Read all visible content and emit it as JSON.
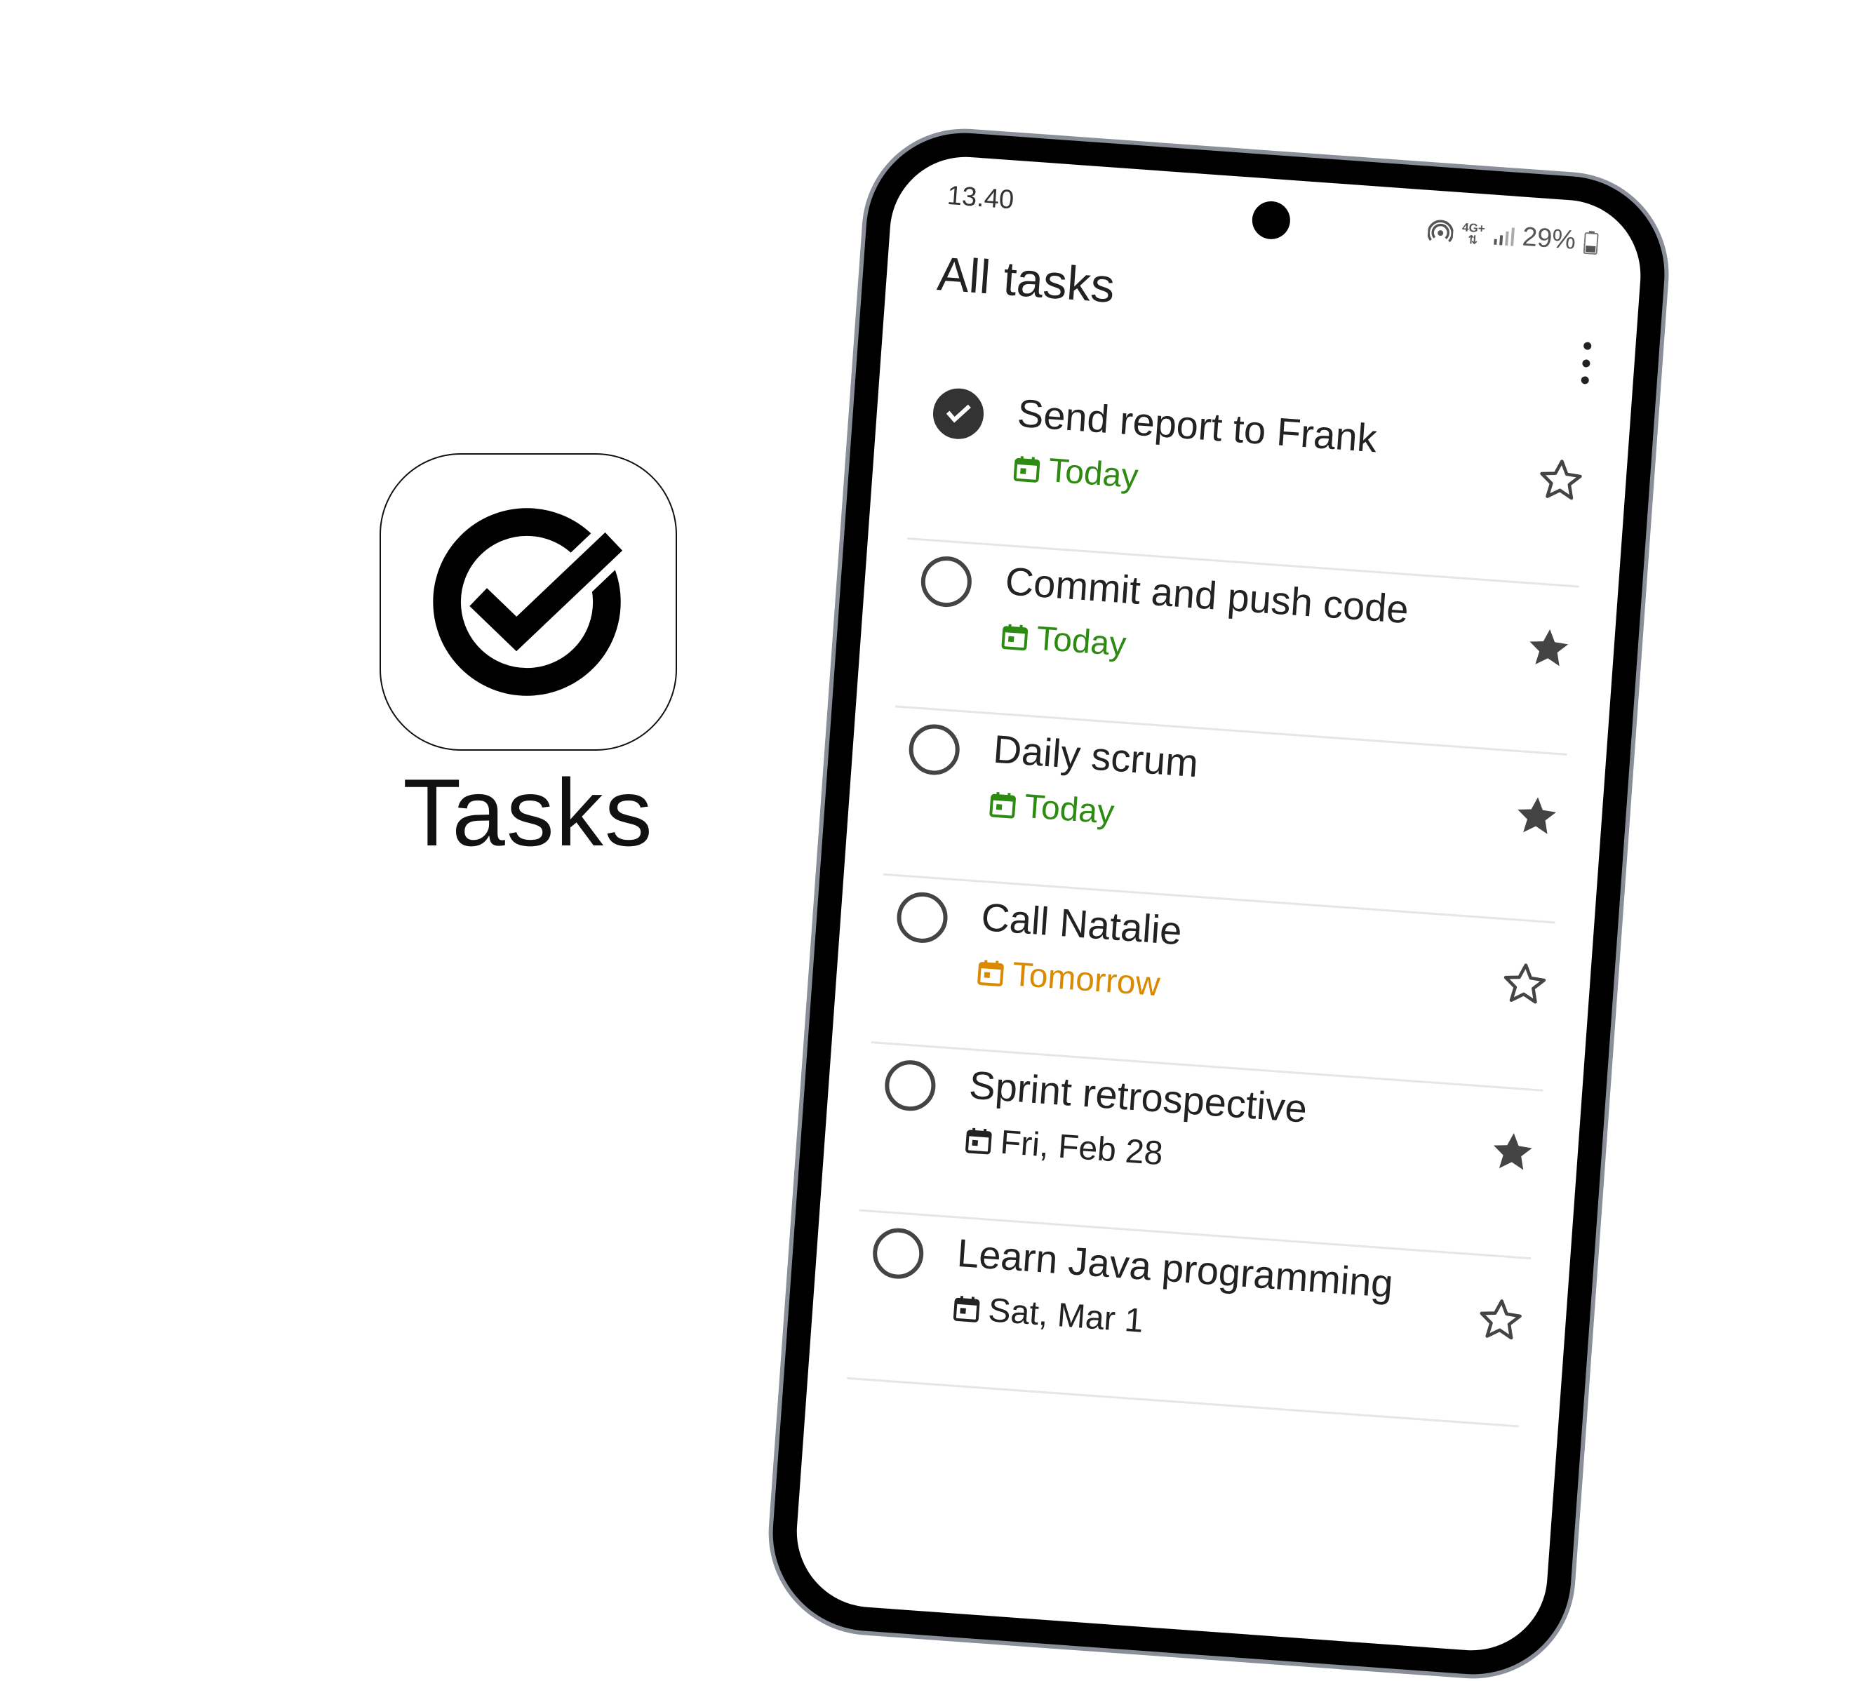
{
  "app": {
    "name": "Tasks",
    "icon": "tasks-check-logo-icon"
  },
  "status_bar": {
    "time": "13.40",
    "network": "4G+",
    "battery": "29%"
  },
  "header": {
    "title": "All tasks",
    "menu_icon": "more-vert-icon"
  },
  "colors": {
    "today": "#2e8b12",
    "tomorrow": "#d98a00",
    "future": "#222222",
    "star": "#444444"
  },
  "tasks": [
    {
      "title": "Send report to Frank",
      "due": "Today",
      "completed": true,
      "starred": false
    },
    {
      "title": "Commit and push code",
      "due": "Today",
      "completed": false,
      "starred": true
    },
    {
      "title": "Daily scrum",
      "due": "Today",
      "completed": false,
      "starred": true
    },
    {
      "title": "Call Natalie",
      "due": "Tomorrow",
      "completed": false,
      "starred": false
    },
    {
      "title": "Sprint retrospective",
      "due": "Fri, Feb 28",
      "completed": false,
      "starred": true
    },
    {
      "title": "Learn Java programming",
      "due": "Sat, Mar 1",
      "completed": false,
      "starred": false
    }
  ]
}
